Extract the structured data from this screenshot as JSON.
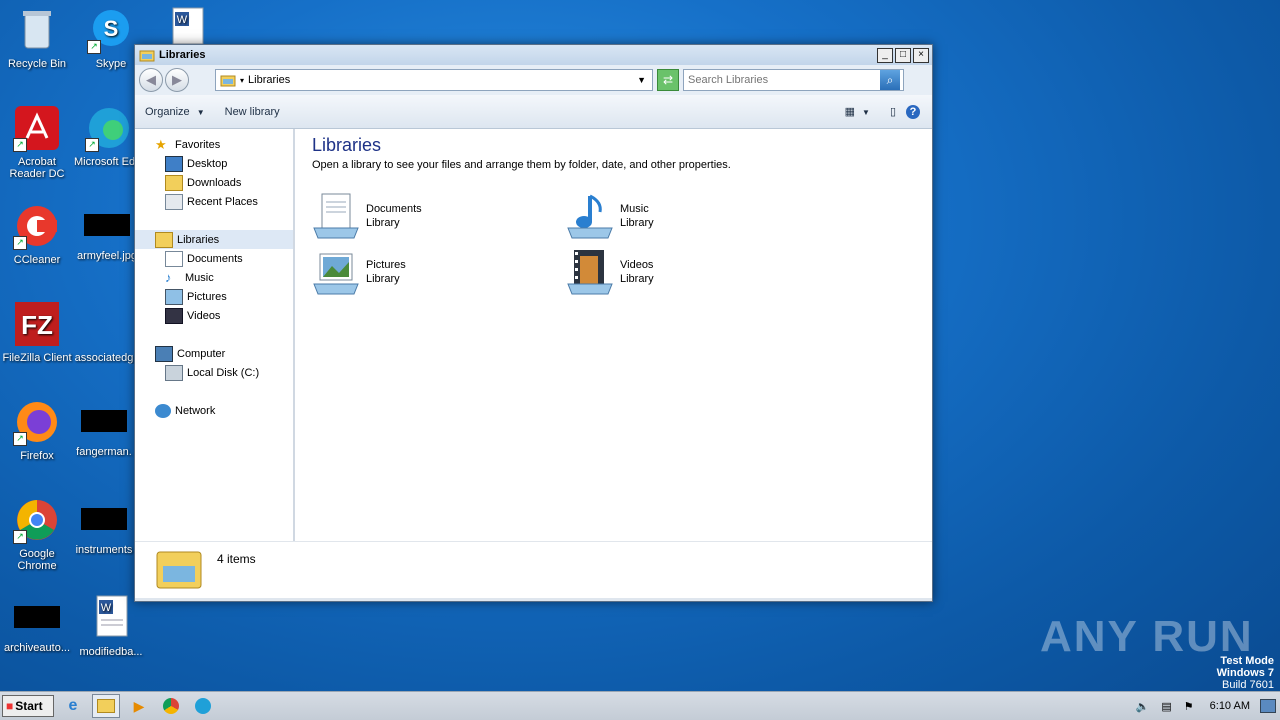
{
  "desktop": {
    "icons": [
      {
        "label": "Recycle Bin"
      },
      {
        "label": "Skype"
      },
      {
        "label": "Acrobat Reader DC"
      },
      {
        "label": "Microsoft Edge"
      },
      {
        "label": "CCleaner"
      },
      {
        "label": "armyfeel.jpg"
      },
      {
        "label": "FileZilla Client"
      },
      {
        "label": "associatedg"
      },
      {
        "label": "Firefox"
      },
      {
        "label": "fangerman."
      },
      {
        "label": "Google Chrome"
      },
      {
        "label": "instruments"
      },
      {
        "label": "archiveauto..."
      },
      {
        "label": "modifiedba..."
      }
    ],
    "watermark": {
      "line1": "Test Mode",
      "line2": "Windows 7",
      "line3": "Build 7601"
    },
    "brand": "ANY RUN"
  },
  "window": {
    "title": "Libraries",
    "address": "Libraries",
    "search_placeholder": "Search Libraries",
    "toolbar": {
      "organize": "Organize",
      "new_library": "New library"
    },
    "nav": {
      "favorites": "Favorites",
      "desktop": "Desktop",
      "downloads": "Downloads",
      "recent": "Recent Places",
      "libraries": "Libraries",
      "documents": "Documents",
      "music": "Music",
      "pictures": "Pictures",
      "videos": "Videos",
      "computer": "Computer",
      "local_disk": "Local Disk (C:)",
      "network": "Network"
    },
    "main": {
      "heading": "Libraries",
      "description": "Open a library to see your files and arrange them by folder, date, and other properties.",
      "libraries": [
        {
          "name": "Documents",
          "type": "Library"
        },
        {
          "name": "Music",
          "type": "Library"
        },
        {
          "name": "Pictures",
          "type": "Library"
        },
        {
          "name": "Videos",
          "type": "Library"
        }
      ]
    },
    "status": "4 items"
  },
  "taskbar": {
    "start": "Start",
    "clock": "6:10 AM"
  }
}
